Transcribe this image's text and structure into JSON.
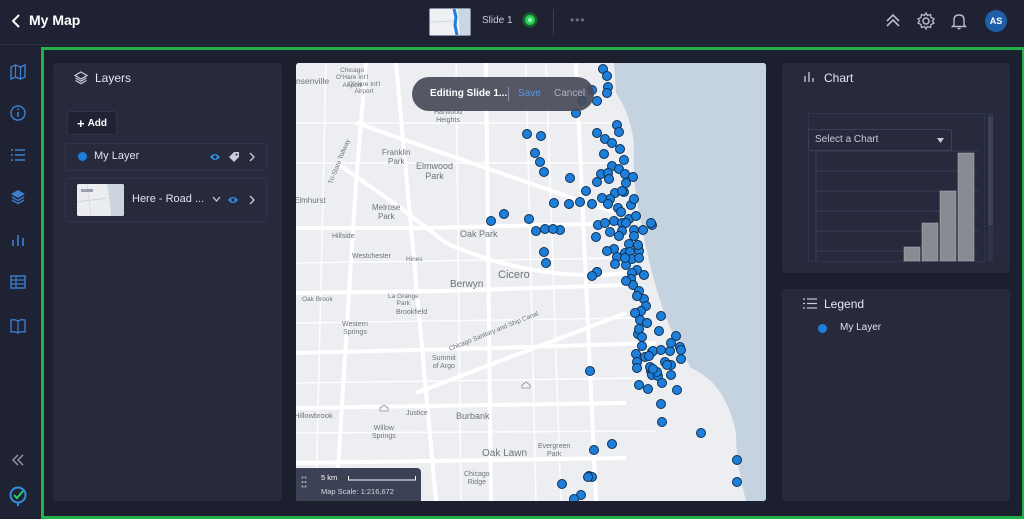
{
  "header": {
    "title": "My Map",
    "slide_label": "Slide 1",
    "more_label": "•••",
    "avatar_initials": "AS"
  },
  "rail": {
    "icons": [
      "map-icon",
      "info-icon",
      "list-icon",
      "layers-icon",
      "bar-chart-icon",
      "table-icon",
      "book-icon"
    ],
    "collapse_icon": "double-chevron-left-icon",
    "logo": "globe-logo-icon"
  },
  "layers_panel": {
    "title": "Layers",
    "add_label": "Add",
    "layers": [
      {
        "name": "My Layer",
        "color": "#1d7fd9"
      },
      {
        "name": "Here - Road ..."
      }
    ]
  },
  "map": {
    "edit_banner": {
      "text": "Editing Slide 1...",
      "save_label": "Save",
      "cancel_label": "Cancel"
    },
    "scale": {
      "distance": "5 km",
      "scale_text": "Map Scale: 1:216,672"
    },
    "places": [
      "O'Hare Int'l\nAirport",
      "Chicago\nO'Hare Int'l\nAirport",
      "Harwood\nHeights",
      "Franklin\nPark",
      "Elmwood\nPark",
      "Melrose\nPark",
      "Oak Park",
      "Westchester",
      "Cicero",
      "Berwyn",
      "Brookfield",
      "Western\nSprings",
      "Summit\nof Argo",
      "Burbank",
      "Oak Lawn",
      "Evergreen\nPark",
      "Chicago\nRidge",
      "Hillside",
      "Hines",
      "Elmhurst",
      "La Grange\nPark",
      "Oak Brook",
      "Justice",
      "Willow\nSprings",
      "Hillowbrook",
      "Tri-State Tollway",
      "Chicago Sanitary and Ship Canal",
      "nsenville"
    ]
  },
  "chart_panel": {
    "title": "Chart",
    "select_label": "Select a Chart"
  },
  "legend_panel": {
    "title": "Legend",
    "items": [
      {
        "name": "My Layer",
        "color": "#1d7fd9"
      }
    ]
  },
  "colors": {
    "accent_green": "#22b14c",
    "point_blue": "#1d7fd9",
    "panel_bg": "#262a3c",
    "app_bg": "#1f2233"
  }
}
